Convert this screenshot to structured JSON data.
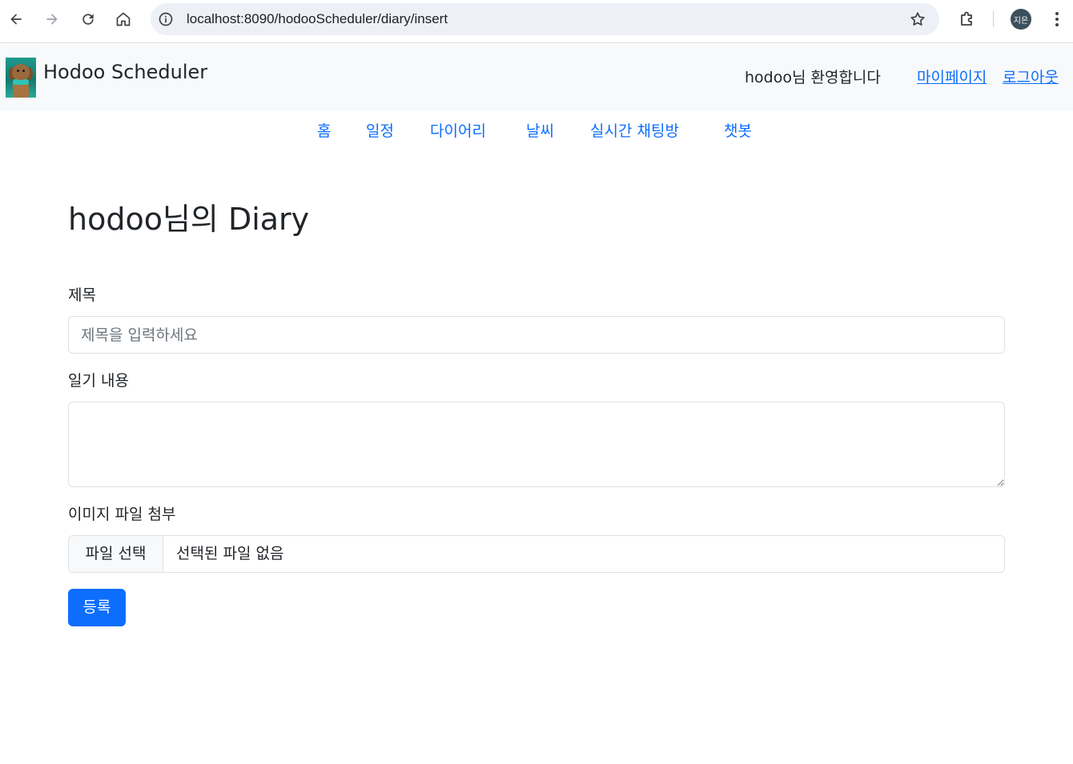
{
  "browser": {
    "url": "localhost:8090/hodooScheduler/diary/insert",
    "profile_initials": "지은"
  },
  "header": {
    "brand": "Hodoo Scheduler",
    "welcome": "hodoo님 환영합니다",
    "mypage_link": "마이페이지",
    "logout_link": "로그아웃"
  },
  "nav": {
    "items": [
      "홈",
      "일정",
      "다이어리",
      "날씨",
      "실시간 채팅방",
      "챗봇"
    ]
  },
  "page": {
    "title": "hodoo님의 Diary"
  },
  "form": {
    "title_label": "제목",
    "title_placeholder": "제목을 입력하세요",
    "title_value": "",
    "content_label": "일기 내용",
    "content_value": "",
    "image_label": "이미지 파일 첨부",
    "file_button": "파일 선택",
    "file_status": "선택된 파일 없음",
    "submit_label": "등록"
  },
  "colors": {
    "primary": "#0d6efd",
    "header_bg": "#f8f9fa",
    "border": "#dee2e6"
  }
}
